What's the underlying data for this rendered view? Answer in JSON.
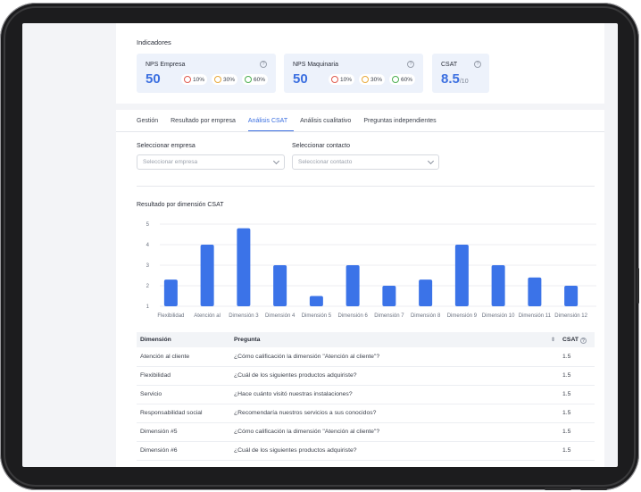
{
  "indicators": {
    "title": "Indicadores",
    "cards": [
      {
        "title": "NPS Empresa",
        "value": "50",
        "unit": "",
        "pcts": [
          "10%",
          "30%",
          "60%"
        ]
      },
      {
        "title": "NPS Maquinaria",
        "value": "50",
        "unit": "",
        "pcts": [
          "10%",
          "30%",
          "60%"
        ]
      },
      {
        "title": "CSAT",
        "value": "8.5",
        "unit": "/10",
        "pcts": []
      }
    ],
    "help_icon": "?"
  },
  "tabs": [
    {
      "label": "Gestión",
      "active": false
    },
    {
      "label": "Resultado por empresa",
      "active": false
    },
    {
      "label": "Análisis CSAT",
      "active": true
    },
    {
      "label": "Análisis cualitativo",
      "active": false
    },
    {
      "label": "Preguntas independientes",
      "active": false
    }
  ],
  "filters": {
    "company": {
      "label": "Seleccionar empresa",
      "placeholder": "Seleccionar empresa"
    },
    "contact": {
      "label": "Seleccionar contacto",
      "placeholder": "Seleccionar contacto"
    }
  },
  "colors": {
    "accent": "#3b6fe0",
    "bar": "#3b73e8",
    "bad": "#e05a4f",
    "neutral": "#e8a93a",
    "good": "#4caf50"
  },
  "chart_data": {
    "type": "bar",
    "title": "Resultado por dimensión CSAT",
    "categories": [
      "Flexibilidad",
      "Atención al",
      "Dimensión 3",
      "Dimensión 4",
      "Dimensión 5",
      "Dimensión 6",
      "Dimensión 7",
      "Dimensión 8",
      "Dimensión 9",
      "Dimensión 10",
      "Dimensión 11",
      "Dimensión 12"
    ],
    "values": [
      2.3,
      4.0,
      4.8,
      3.0,
      1.5,
      3.0,
      2.0,
      2.3,
      4.0,
      3.0,
      2.4,
      2.0
    ],
    "yticks": [
      "5",
      "4",
      "3",
      "2",
      "1"
    ],
    "ylim": [
      1,
      5
    ],
    "grid": true
  },
  "table": {
    "headers": {
      "dimension": "Dimensión",
      "question": "Pregunta",
      "csat": "CSAT"
    },
    "rows": [
      {
        "dimension": "Atención al cliente",
        "question": "¿Cómo calificación la dimensión \"Atención al cliente\"?",
        "csat": "1.5"
      },
      {
        "dimension": "Flexibilidad",
        "question": "¿Cuál de los siguientes productos adquiriste?",
        "csat": "1.5"
      },
      {
        "dimension": "Servicio",
        "question": "¿Hace cuánto visitó nuestras instalaciones?",
        "csat": "1.5"
      },
      {
        "dimension": "Responsabilidad social",
        "question": "¿Recomendaría nuestros servicios a sus conocidos?",
        "csat": "1.5"
      },
      {
        "dimension": "Dimensión #5",
        "question": "¿Cómo calificación la dimensión \"Atención al cliente\"?",
        "csat": "1.5"
      },
      {
        "dimension": "Dimensión #6",
        "question": "¿Cuál de los siguientes productos adquiriste?",
        "csat": "1.5"
      }
    ]
  }
}
